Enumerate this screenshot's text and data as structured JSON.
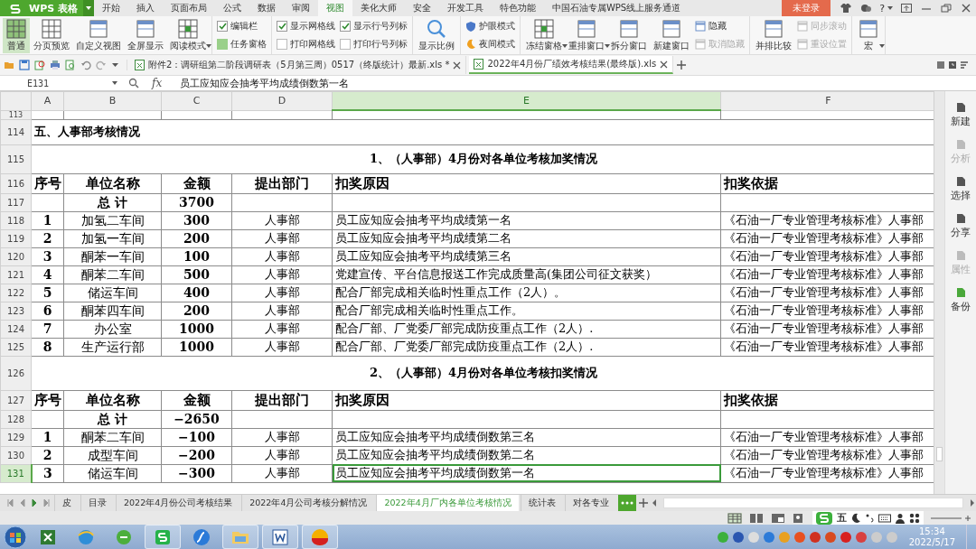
{
  "app": {
    "name": "WPS 表格"
  },
  "menu_tabs": [
    {
      "label": "开始",
      "selected": false
    },
    {
      "label": "插入",
      "selected": false
    },
    {
      "label": "页面布局",
      "selected": false
    },
    {
      "label": "公式",
      "selected": false
    },
    {
      "label": "数据",
      "selected": false
    },
    {
      "label": "审阅",
      "selected": false
    },
    {
      "label": "视图",
      "selected": true
    },
    {
      "label": "美化大师",
      "selected": false
    },
    {
      "label": "安全",
      "selected": false
    },
    {
      "label": "开发工具",
      "selected": false
    },
    {
      "label": "特色功能",
      "selected": false
    },
    {
      "label": "中国石油专属WPS线上服务通道",
      "selected": false
    }
  ],
  "login_button": "未登录",
  "help": "?",
  "ribbon": [
    {
      "columns": [
        [
          {
            "kind": "large",
            "label": "普通",
            "selected": true
          }
        ],
        [
          {
            "kind": "large",
            "label": "分页预览",
            "selected": false
          }
        ],
        [
          {
            "kind": "large",
            "label": "自定义视图",
            "selected": false
          }
        ],
        [
          {
            "kind": "large",
            "label": "全屏显示",
            "selected": false
          }
        ],
        [
          {
            "kind": "large",
            "label": "阅读模式",
            "selected": false,
            "dropdown": true
          }
        ]
      ]
    },
    {
      "columns": [
        [
          {
            "kind": "check",
            "label": "编辑栏",
            "checked": true
          },
          {
            "kind": "toggle",
            "label": "任务窗格",
            "on": true
          }
        ]
      ]
    },
    {
      "columns": [
        [
          {
            "kind": "check",
            "label": "显示网格线",
            "checked": true
          },
          {
            "kind": "check",
            "label": "打印网格线",
            "checked": false
          }
        ],
        [
          {
            "kind": "check",
            "label": "显示行号列标",
            "checked": true
          },
          {
            "kind": "check",
            "label": "打印行号列标",
            "checked": false
          }
        ]
      ]
    },
    {
      "columns": [
        [
          {
            "kind": "large",
            "label": "显示比例"
          }
        ]
      ]
    },
    {
      "columns": [
        [
          {
            "kind": "small",
            "label": "护眼模式"
          },
          {
            "kind": "small",
            "label": "夜间模式"
          }
        ]
      ]
    },
    {
      "columns": [
        [
          {
            "kind": "large",
            "label": "冻结窗格",
            "dropdown": true
          }
        ],
        [
          {
            "kind": "large",
            "label": "重排窗口",
            "dropdown": true
          }
        ],
        [
          {
            "kind": "large",
            "label": "拆分窗口"
          }
        ],
        [
          {
            "kind": "large",
            "label": "新建窗口"
          }
        ],
        [
          {
            "kind": "small",
            "label": "隐藏",
            "disabled": false
          },
          {
            "kind": "small",
            "label": "取消隐藏",
            "disabled": true
          }
        ]
      ]
    },
    {
      "columns": [
        [
          {
            "kind": "large",
            "label": "并排比较"
          }
        ],
        [
          {
            "kind": "small",
            "label": "同步滚动",
            "disabled": true
          },
          {
            "kind": "small",
            "label": "重设位置",
            "disabled": true
          }
        ]
      ]
    },
    {
      "columns": [
        [
          {
            "kind": "large",
            "label": "宏",
            "dropdown": true
          }
        ]
      ]
    }
  ],
  "document_tabs": [
    {
      "label": "附件2：调研组第二阶段调研表（5月第三周）0517（终版统计）最新.xls *",
      "selected": false
    },
    {
      "label": "2022年4月份厂绩效考核结果(最终版).xls",
      "selected": true
    }
  ],
  "formula_bar": {
    "cell_ref": "E131",
    "fx": "fx",
    "value": "员工应知应会抽考平均成绩倒数第一名"
  },
  "sheet": {
    "columns": [
      {
        "label": "A",
        "selected": false
      },
      {
        "label": "B",
        "selected": false
      },
      {
        "label": "C",
        "selected": false
      },
      {
        "label": "D",
        "selected": false
      },
      {
        "label": "E",
        "selected": true
      },
      {
        "label": "F",
        "selected": false
      }
    ],
    "rows": [
      {
        "number": "113",
        "kind": "blank",
        "selected": false
      },
      {
        "number": "114",
        "kind": "section",
        "selected": false,
        "section_heading": "五、人事部考核情况"
      },
      {
        "number": "115",
        "kind": "title",
        "selected": false,
        "heading": "1、（人事部）4月份对各单位考核加奖情况"
      },
      {
        "number": "116",
        "kind": "header",
        "selected": false,
        "no": "序号",
        "unit": "单位名称",
        "amount": "金额",
        "dept": "提出部门",
        "reason": "扣奖原因",
        "basis": "扣奖依据"
      },
      {
        "number": "117",
        "kind": "total",
        "selected": false,
        "unit": "总 计",
        "amount": "3700"
      },
      {
        "number": "118",
        "kind": "data",
        "selected": false,
        "no": "1",
        "unit": "加氢二车间",
        "amount": "300",
        "dept": "人事部",
        "reason": "员工应知应会抽考平均成绩第一名",
        "basis": "《石油一厂专业管理考核标准》人事部"
      },
      {
        "number": "119",
        "kind": "data",
        "selected": false,
        "no": "2",
        "unit": "加氢一车间",
        "amount": "200",
        "dept": "人事部",
        "reason": "员工应知应会抽考平均成绩第二名",
        "basis": "《石油一厂专业管理考核标准》人事部"
      },
      {
        "number": "120",
        "kind": "data",
        "selected": false,
        "no": "3",
        "unit": "酮苯一车间",
        "amount": "100",
        "dept": "人事部",
        "reason": "员工应知应会抽考平均成绩第三名",
        "basis": "《石油一厂专业管理考核标准》人事部"
      },
      {
        "number": "121",
        "kind": "data",
        "selected": false,
        "no": "4",
        "unit": "酮苯二车间",
        "amount": "500",
        "dept": "人事部",
        "reason": "党建宣传、平台信息报送工作完成质量高(集团公司征文获奖）",
        "basis": "《石油一厂专业管理考核标准》人事部"
      },
      {
        "number": "122",
        "kind": "data",
        "selected": false,
        "no": "5",
        "unit": "储运车间",
        "amount": "400",
        "dept": "人事部",
        "reason": "配合厂部完成相关临时性重点工作（2人）。",
        "basis": "《石油一厂专业管理考核标准》人事部"
      },
      {
        "number": "123",
        "kind": "data",
        "selected": false,
        "no": "6",
        "unit": "酮苯四车间",
        "amount": "200",
        "dept": "人事部",
        "reason": "配合厂部完成相关临时性重点工作。",
        "basis": "《石油一厂专业管理考核标准》人事部"
      },
      {
        "number": "124",
        "kind": "data",
        "selected": false,
        "no": "7",
        "unit": "办公室",
        "amount": "1000",
        "dept": "人事部",
        "reason": "配合厂部、厂党委厂部完成防疫重点工作（2人）.",
        "basis": "《石油一厂专业管理考核标准》人事部"
      },
      {
        "number": "125",
        "kind": "data",
        "selected": false,
        "no": "8",
        "unit": "生产运行部",
        "amount": "1000",
        "dept": "人事部",
        "reason": "配合厂部、厂党委厂部完成防疫重点工作（2人）.",
        "basis": "《石油一厂专业管理考核标准》人事部"
      },
      {
        "number": "126",
        "kind": "title",
        "selected": false,
        "heading": "2、（人事部）4月份对各单位考核扣奖情况"
      },
      {
        "number": "127",
        "kind": "header",
        "selected": false,
        "no": "序号",
        "unit": "单位名称",
        "amount": "金额",
        "dept": "提出部门",
        "reason": "扣奖原因",
        "basis": "扣奖依据"
      },
      {
        "number": "128",
        "kind": "total",
        "selected": false,
        "unit": "总 计",
        "amount": "−2650"
      },
      {
        "number": "129",
        "kind": "data",
        "selected": false,
        "no": "1",
        "unit": "酮苯二车间",
        "amount": "−100",
        "dept": "人事部",
        "reason": "员工应知应会抽考平均成绩倒数第三名",
        "basis": "《石油一厂专业管理考核标准》人事部"
      },
      {
        "number": "130",
        "kind": "data",
        "selected": false,
        "no": "2",
        "unit": "成型车间",
        "amount": "−200",
        "dept": "人事部",
        "reason": "员工应知应会抽考平均成绩倒数第二名",
        "basis": "《石油一厂专业管理考核标准》人事部"
      },
      {
        "number": "131",
        "kind": "data",
        "selected": true,
        "no": "3",
        "unit": "储运车间",
        "amount": "−300",
        "dept": "人事部",
        "reason": "员工应知应会抽考平均成绩倒数第一名",
        "basis": "《石油一厂专业管理考核标准》人事部"
      }
    ]
  },
  "side_panel": [
    {
      "label": "新建",
      "disabled": false
    },
    {
      "label": "分析",
      "disabled": true
    },
    {
      "label": "选择",
      "disabled": false
    },
    {
      "label": "分享",
      "disabled": false
    },
    {
      "label": "属性",
      "disabled": true
    },
    {
      "label": "备份",
      "disabled": false
    }
  ],
  "sheet_tabs": [
    {
      "label": "皮",
      "selected": false
    },
    {
      "label": "目录",
      "selected": false
    },
    {
      "label": "2022年4月份公司考核结果",
      "selected": false
    },
    {
      "label": "2022年4月公司考核分解情况",
      "selected": false
    },
    {
      "label": "2022年4月厂内各单位考核情况",
      "selected": true
    },
    {
      "label": "统计表",
      "selected": false
    },
    {
      "label": "对各专业",
      "selected": false
    }
  ],
  "ime_bar": {
    "mode": "五"
  },
  "taskbar": {
    "time": "15:34",
    "date": "2022/5/17"
  }
}
